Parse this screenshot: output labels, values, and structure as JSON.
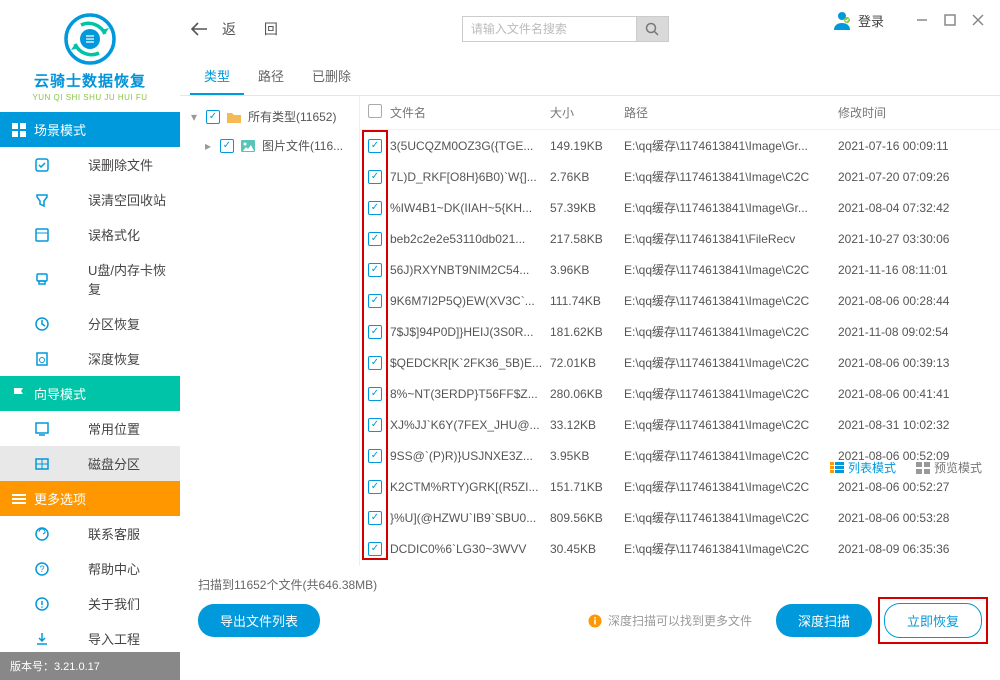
{
  "window": {
    "login": "登录"
  },
  "logo": {
    "title": "云骑士数据恢复",
    "sub": "YUN QI SHI SHU JU HUI FU"
  },
  "sidebar": {
    "scene_header": "场景模式",
    "wizard_header": "向导模式",
    "more_header": "更多选项",
    "scene_items": [
      "误删除文件",
      "误清空回收站",
      "误格式化",
      "U盘/内存卡恢复",
      "分区恢复",
      "深度恢复"
    ],
    "wizard_items": [
      "常用位置",
      "磁盘分区"
    ],
    "more_items": [
      "联系客服",
      "帮助中心",
      "关于我们",
      "导入工程"
    ]
  },
  "topbar": {
    "back": "返  回"
  },
  "search": {
    "placeholder": "请输入文件名搜索"
  },
  "tabs": [
    "类型",
    "路径",
    "已删除"
  ],
  "tree": {
    "all": "所有类型(11652)",
    "img": "图片文件(116..."
  },
  "columns": {
    "name": "文件名",
    "size": "大小",
    "path": "路径",
    "date": "修改时间"
  },
  "rows": [
    {
      "name": "3(5UCQZM0OZ3G({TGE...",
      "size": "149.19KB",
      "path": "E:\\qq缓存\\1174613841\\Image\\Gr...",
      "date": "2021-07-16 00:09:11"
    },
    {
      "name": "7L)D_RKF[O8H}6B0)`W{]...",
      "size": "2.76KB",
      "path": "E:\\qq缓存\\1174613841\\Image\\C2C",
      "date": "2021-07-20 07:09:26"
    },
    {
      "name": "%IW4B1~DK(IIAH~5{KH...",
      "size": "57.39KB",
      "path": "E:\\qq缓存\\1174613841\\Image\\Gr...",
      "date": "2021-08-04 07:32:42"
    },
    {
      "name": "beb2c2e2e53110db021...",
      "size": "217.58KB",
      "path": "E:\\qq缓存\\1174613841\\FileRecv",
      "date": "2021-10-27 03:30:06"
    },
    {
      "name": "56J)RXYNBT9NIM2C54...",
      "size": "3.96KB",
      "path": "E:\\qq缓存\\1174613841\\Image\\C2C",
      "date": "2021-11-16 08:11:01"
    },
    {
      "name": "9K6M7I2P5Q)EW(XV3C`...",
      "size": "111.74KB",
      "path": "E:\\qq缓存\\1174613841\\Image\\C2C",
      "date": "2021-08-06 00:28:44"
    },
    {
      "name": "7$J$]94P0D]}HEIJ(3S0R...",
      "size": "181.62KB",
      "path": "E:\\qq缓存\\1174613841\\Image\\C2C",
      "date": "2021-11-08 09:02:54"
    },
    {
      "name": "$QEDCKR[K`2FK36_5B)E...",
      "size": "72.01KB",
      "path": "E:\\qq缓存\\1174613841\\Image\\C2C",
      "date": "2021-08-06 00:39:13"
    },
    {
      "name": "8%~NT(3ERDP}T56FF$Z...",
      "size": "280.06KB",
      "path": "E:\\qq缓存\\1174613841\\Image\\C2C",
      "date": "2021-08-06 00:41:41"
    },
    {
      "name": "XJ%JJ`K6Y(7FEX_JHU@...",
      "size": "33.12KB",
      "path": "E:\\qq缓存\\1174613841\\Image\\C2C",
      "date": "2021-08-31 10:02:32"
    },
    {
      "name": "9SS@`(P)R)}USJNXE3Z...",
      "size": "3.95KB",
      "path": "E:\\qq缓存\\1174613841\\Image\\C2C",
      "date": "2021-08-06 00:52:09"
    },
    {
      "name": "K2CTM%RTY)GRK[(R5ZI...",
      "size": "151.71KB",
      "path": "E:\\qq缓存\\1174613841\\Image\\C2C",
      "date": "2021-08-06 00:52:27"
    },
    {
      "name": "}%U](@HZWU`IB9`SBU0...",
      "size": "809.56KB",
      "path": "E:\\qq缓存\\1174613841\\Image\\C2C",
      "date": "2021-08-06 00:53:28"
    },
    {
      "name": "DCDIC0%6`LG30~3WVV",
      "size": "30.45KB",
      "path": "E:\\qq缓存\\1174613841\\Image\\C2C",
      "date": "2021-08-09 06:35:36"
    }
  ],
  "viewmode": {
    "list": "列表模式",
    "preview": "预览模式"
  },
  "footer": {
    "scaninfo": "扫描到11652个文件(共646.38MB)",
    "export": "导出文件列表",
    "tip": "深度扫描可以找到更多文件",
    "deep": "深度扫描",
    "recover": "立即恢复"
  },
  "version": "版本号：3.21.0.17"
}
